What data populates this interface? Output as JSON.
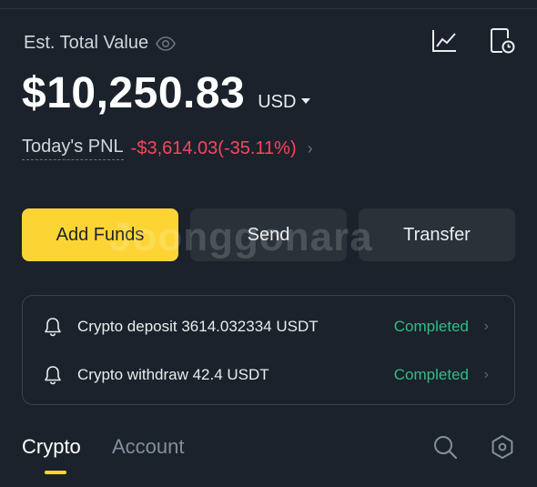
{
  "header": {
    "est_label": "Est. Total Value",
    "total_value": "$10,250.83",
    "currency": "USD",
    "pnl_label": "Today's PNL",
    "pnl_value": "-$3,614.03(-35.11%)"
  },
  "actions": {
    "add_funds": "Add Funds",
    "send": "Send",
    "transfer": "Transfer"
  },
  "watermark": "Joonggonara",
  "notices": [
    {
      "text": "Crypto deposit 3614.032334 USDT",
      "status": "Completed"
    },
    {
      "text": "Crypto withdraw 42.4 USDT",
      "status": "Completed"
    }
  ],
  "tabs": {
    "crypto": "Crypto",
    "account": "Account"
  },
  "colors": {
    "accent": "#fcd535",
    "negative": "#f6465d",
    "positive": "#2ebd85",
    "background": "#1b222b"
  },
  "icons": [
    "eye-icon",
    "chart-icon",
    "history-icon",
    "chevron-down-icon",
    "chevron-right-icon",
    "bell-icon",
    "search-icon",
    "settings-icon"
  ]
}
